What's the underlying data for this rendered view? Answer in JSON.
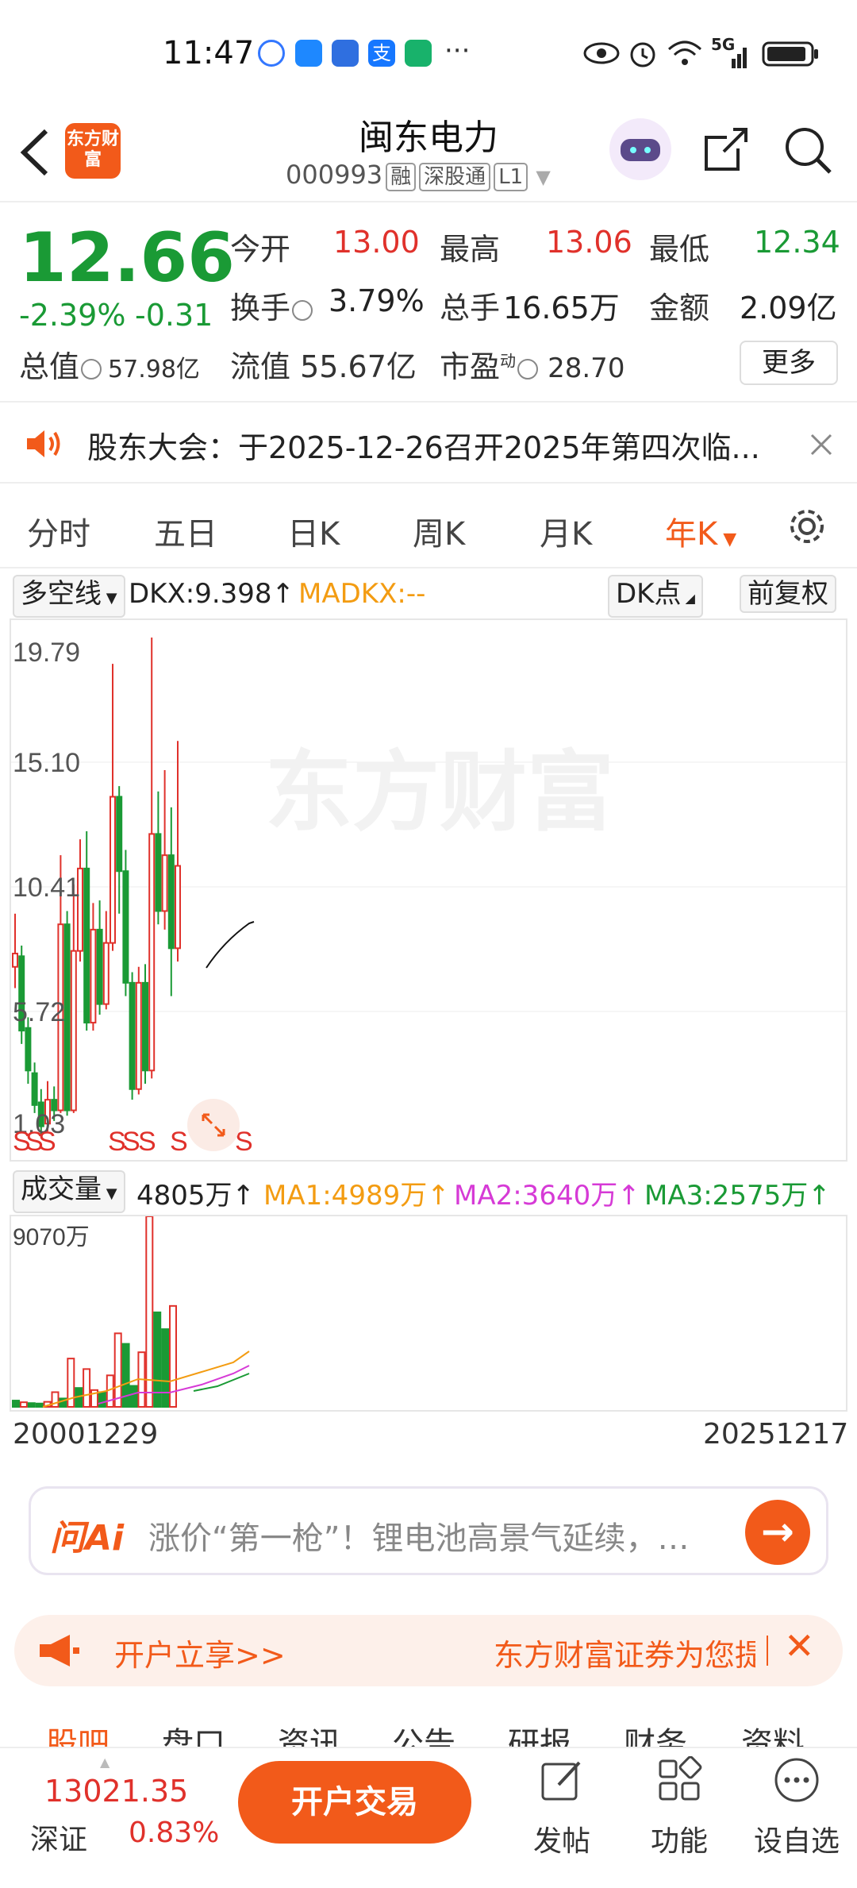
{
  "status_bar": {
    "time": "11:47",
    "network": "5G"
  },
  "header": {
    "logo_text": "东方财富",
    "stock_name": "闽东电力",
    "stock_code": "000993",
    "tags": [
      "融",
      "深股通",
      "L1"
    ]
  },
  "quote": {
    "price": "12.66",
    "change_pct": "-2.39%",
    "change_abs": "-0.31",
    "open_label": "今开",
    "open": "13.00",
    "high_label": "最高",
    "high": "13.06",
    "low_label": "最低",
    "low": "12.34",
    "turnover_label": "换手",
    "turnover": "3.79%",
    "volume_label": "总手",
    "volume": "16.65万",
    "amount_label": "金额",
    "amount": "2.09亿",
    "mktcap_label": "总值",
    "mktcap": "57.98亿",
    "float_label": "流值",
    "float_cap": "55.67亿",
    "pe_label": "市盈",
    "pe_sup": "动",
    "pe": "28.70",
    "more_label": "更多"
  },
  "notice": {
    "text": "股东大会：于2025-12-26召开2025年第四次临..."
  },
  "tabs": [
    {
      "label": "分时"
    },
    {
      "label": "五日"
    },
    {
      "label": "日K"
    },
    {
      "label": "周K"
    },
    {
      "label": "月K"
    },
    {
      "label": "年K"
    }
  ],
  "indicator": {
    "name": "多空线",
    "dkx": "DKX:9.398↑",
    "madkx": "MADKX:--",
    "dk_btn": "DK点",
    "adjust_btn": "前复权"
  },
  "volume_indicator": {
    "name": "成交量",
    "vol": "4805万↑",
    "ma1": "MA1:4989万↑",
    "ma2": "MA2:3640万↑",
    "ma3": "MA3:2575万↑",
    "axis_top": "9070万"
  },
  "colors": {
    "up": "#e0312b",
    "down": "#1a9a35",
    "accent": "#f25a1a"
  },
  "chart_data": {
    "type": "candlestick",
    "y_ticks": [
      "19.79",
      "15.10",
      "10.41",
      "5.72",
      "1.03"
    ],
    "ylim": [
      1.03,
      19.79
    ],
    "x_start_label": "20001229",
    "x_end_label": "20251217",
    "watermark": "东方财富",
    "signals": [
      "S",
      "S",
      "S",
      "S",
      "S",
      "S",
      "S",
      "S"
    ],
    "candles": [
      {
        "o": 7.4,
        "c": 7.9,
        "h": 9.4,
        "l": 6.6,
        "up": true
      },
      {
        "o": 7.8,
        "c": 5.0,
        "h": 8.2,
        "l": 4.5,
        "up": false
      },
      {
        "o": 5.1,
        "c": 3.5,
        "h": 5.5,
        "l": 3.0,
        "up": false
      },
      {
        "o": 3.4,
        "c": 2.2,
        "h": 3.8,
        "l": 1.9,
        "up": false
      },
      {
        "o": 2.3,
        "c": 1.4,
        "h": 2.8,
        "l": 1.0,
        "up": false
      },
      {
        "o": 1.5,
        "c": 2.4,
        "h": 3.1,
        "l": 1.2,
        "up": true
      },
      {
        "o": 2.4,
        "c": 2.0,
        "h": 2.9,
        "l": 1.6,
        "up": false
      },
      {
        "o": 2.0,
        "c": 9.0,
        "h": 11.6,
        "l": 1.9,
        "up": true
      },
      {
        "o": 9.0,
        "c": 2.0,
        "h": 9.5,
        "l": 1.8,
        "up": false
      },
      {
        "o": 2.0,
        "c": 8.0,
        "h": 10.5,
        "l": 1.9,
        "up": true
      },
      {
        "o": 8.0,
        "c": 11.1,
        "h": 12.2,
        "l": 7.6,
        "up": true
      },
      {
        "o": 11.1,
        "c": 5.3,
        "h": 12.5,
        "l": 5.0,
        "up": false
      },
      {
        "o": 5.3,
        "c": 8.8,
        "h": 9.8,
        "l": 5.0,
        "up": true
      },
      {
        "o": 8.8,
        "c": 6.0,
        "h": 9.9,
        "l": 5.6,
        "up": false
      },
      {
        "o": 6.0,
        "c": 8.3,
        "h": 9.5,
        "l": 5.8,
        "up": true
      },
      {
        "o": 8.3,
        "c": 13.8,
        "h": 18.8,
        "l": 8.0,
        "up": true
      },
      {
        "o": 13.8,
        "c": 11.0,
        "h": 14.2,
        "l": 9.4,
        "up": false
      },
      {
        "o": 11.0,
        "c": 6.8,
        "h": 11.8,
        "l": 6.3,
        "up": false
      },
      {
        "o": 6.8,
        "c": 2.8,
        "h": 7.2,
        "l": 2.4,
        "up": false
      },
      {
        "o": 2.8,
        "c": 6.8,
        "h": 7.4,
        "l": 2.6,
        "up": true
      },
      {
        "o": 6.8,
        "c": 3.5,
        "h": 7.5,
        "l": 3.0,
        "up": false
      },
      {
        "o": 3.5,
        "c": 12.4,
        "h": 19.79,
        "l": 3.2,
        "up": true
      },
      {
        "o": 12.4,
        "c": 9.5,
        "h": 14.0,
        "l": 9.0,
        "up": false
      },
      {
        "o": 9.5,
        "c": 11.6,
        "h": 14.8,
        "l": 8.8,
        "up": true
      },
      {
        "o": 11.6,
        "c": 8.1,
        "h": 13.4,
        "l": 6.3,
        "up": false
      },
      {
        "o": 8.1,
        "c": 11.2,
        "h": 15.9,
        "l": 7.6,
        "up": true
      }
    ],
    "volumes": [
      {
        "v": 300,
        "up": false
      },
      {
        "v": 220,
        "up": true
      },
      {
        "v": 180,
        "up": false
      },
      {
        "v": 160,
        "up": false
      },
      {
        "v": 240,
        "up": true
      },
      {
        "v": 700,
        "up": true
      },
      {
        "v": 400,
        "up": false
      },
      {
        "v": 2300,
        "up": true
      },
      {
        "v": 900,
        "up": false
      },
      {
        "v": 1800,
        "up": true
      },
      {
        "v": 800,
        "up": true
      },
      {
        "v": 700,
        "up": false
      },
      {
        "v": 1500,
        "up": true
      },
      {
        "v": 3500,
        "up": true
      },
      {
        "v": 3000,
        "up": false
      },
      {
        "v": 1000,
        "up": false
      },
      {
        "v": 2600,
        "up": true
      },
      {
        "v": 9070,
        "up": true
      },
      {
        "v": 4500,
        "up": false
      },
      {
        "v": 3700,
        "up": false
      },
      {
        "v": 4805,
        "up": true
      }
    ]
  },
  "ai_bar": {
    "logo": "问Ai",
    "text": "涨价“第一枪”！锂电池高景气延续，…"
  },
  "promo": {
    "left": "开户立享>>",
    "right": "东方财富证券为您提"
  },
  "sub_tabs": [
    {
      "label": "股吧"
    },
    {
      "label": "盘口"
    },
    {
      "label": "资讯"
    },
    {
      "label": "公告"
    },
    {
      "label": "研报"
    },
    {
      "label": "财务"
    },
    {
      "label": "资料"
    }
  ],
  "bottom_bar": {
    "index_value": "13021.35",
    "index_name": "深证",
    "index_pct": "0.83%",
    "trade_label": "开户交易",
    "post_label": "发帖",
    "func_label": "功能",
    "watch_label": "设自选"
  }
}
